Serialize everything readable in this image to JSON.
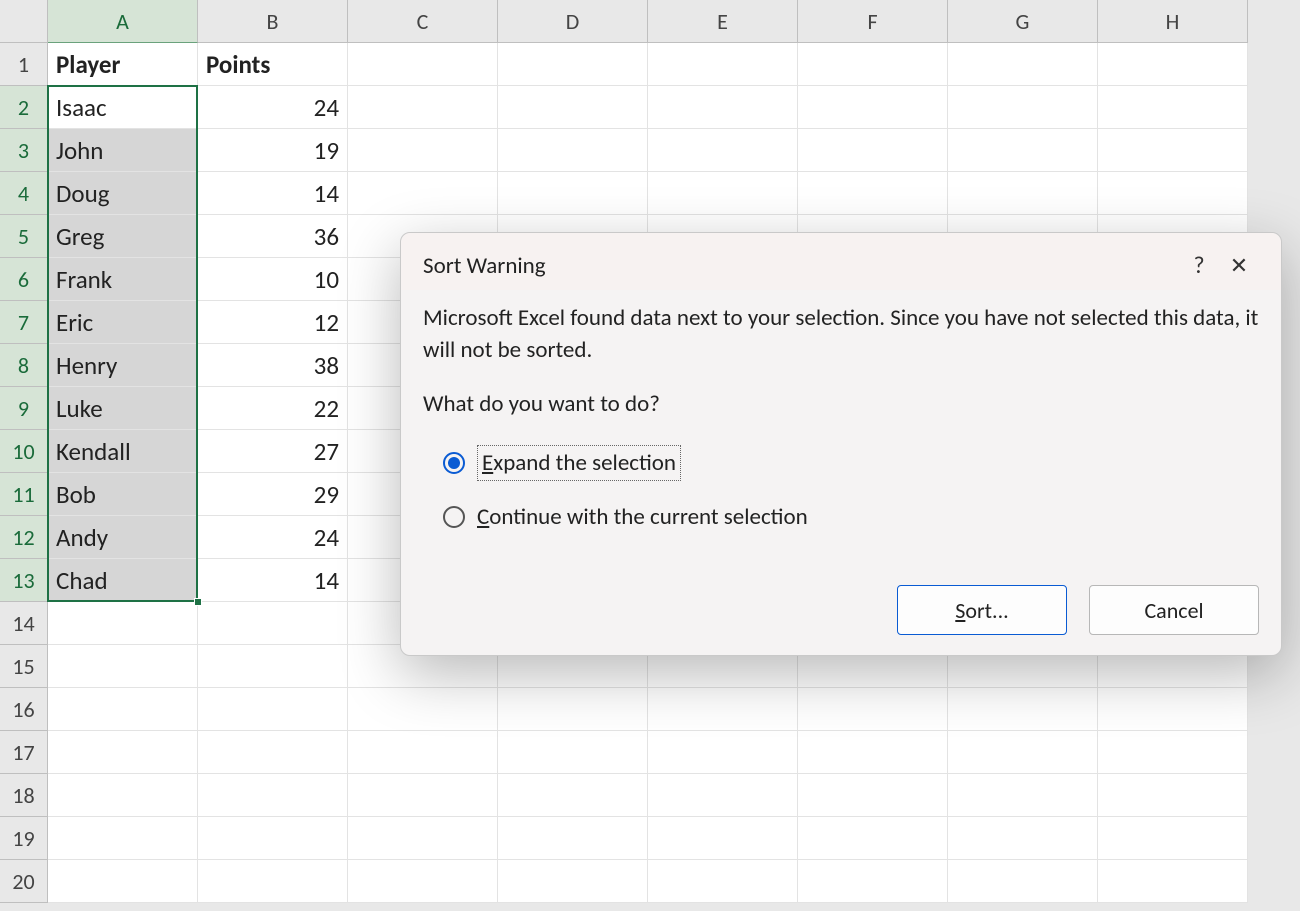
{
  "columns": [
    "A",
    "B",
    "C",
    "D",
    "E",
    "F",
    "G",
    "H"
  ],
  "visible_rows": 20,
  "headers": {
    "A": "Player",
    "B": "Points"
  },
  "data_rows": [
    {
      "player": "Isaac",
      "points": 24
    },
    {
      "player": "John",
      "points": 19
    },
    {
      "player": "Doug",
      "points": 14
    },
    {
      "player": "Greg",
      "points": 36
    },
    {
      "player": "Frank",
      "points": 10
    },
    {
      "player": "Eric",
      "points": 12
    },
    {
      "player": "Henry",
      "points": 38
    },
    {
      "player": "Luke",
      "points": 22
    },
    {
      "player": "Kendall",
      "points": 27
    },
    {
      "player": "Bob",
      "points": 29
    },
    {
      "player": "Andy",
      "points": 24
    },
    {
      "player": "Chad",
      "points": 14
    }
  ],
  "selection": {
    "col": "A",
    "row_start": 2,
    "row_end": 13,
    "active_row": 2
  },
  "dialog": {
    "title": "Sort Warning",
    "help": "?",
    "close": "✕",
    "message": "Microsoft Excel found data next to your selection.  Since you have not selected this data, it will not be sorted.",
    "prompt": "What do you want to do?",
    "option1_pre": "E",
    "option1_rest": "xpand the selection",
    "option2_pre": "C",
    "option2_rest": "ontinue with the current selection",
    "selected_option": 1,
    "sort_pre": "S",
    "sort_rest": "ort...",
    "cancel": "Cancel"
  }
}
